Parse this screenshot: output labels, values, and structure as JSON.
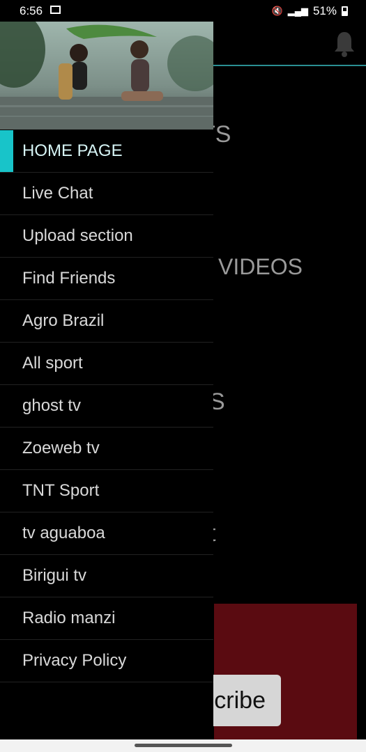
{
  "status_bar": {
    "time": "6:56",
    "battery": "51%",
    "icons": [
      "image-icon",
      "mute-icon",
      "signal-icon",
      "battery-icon"
    ]
  },
  "background": {
    "partial_labels": [
      "TS",
      "VIDEOS",
      "S",
      "t"
    ],
    "subscribe_partial": "cribe",
    "accent_color": "#2a8f93"
  },
  "drawer": {
    "menu_items": [
      {
        "label": "HOME PAGE",
        "active": true
      },
      {
        "label": "Live Chat"
      },
      {
        "label": "Upload section"
      },
      {
        "label": "Find Friends"
      },
      {
        "label": "Agro Brazil"
      },
      {
        "label": "All sport"
      },
      {
        "label": "ghost tv"
      },
      {
        "label": "Zoeweb tv"
      },
      {
        "label": "TNT Sport"
      },
      {
        "label": "tv aguaboa"
      },
      {
        "label": "Birigui tv"
      },
      {
        "label": "Radio manzi"
      },
      {
        "label": "Privacy Policy"
      }
    ],
    "active_color": "#18c4c9"
  }
}
